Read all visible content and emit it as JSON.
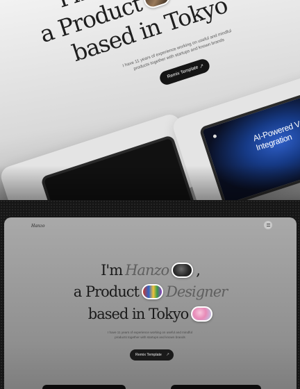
{
  "hero": {
    "intro": "I'm",
    "name": "Hanzo",
    "line2_start": "a Product",
    "role": "Designer",
    "line3": "based in Tokyo",
    "comma": ","
  },
  "description": "I have 11 years of experience working on useful and mindful products together with startups and known brands",
  "cta": {
    "label": "Remix Template",
    "icon": "arrow-up-right-icon"
  },
  "nav": {
    "brand": "Hanzo",
    "menu_icon": "menu-icon"
  },
  "mockup": {
    "ai_text_line1": "AI-Powered V",
    "ai_text_line2": "Integration"
  },
  "colors": {
    "accent_dark": "#151515",
    "screen_blue": "#2f5fc8",
    "text_muted": "#8d8d8d"
  }
}
